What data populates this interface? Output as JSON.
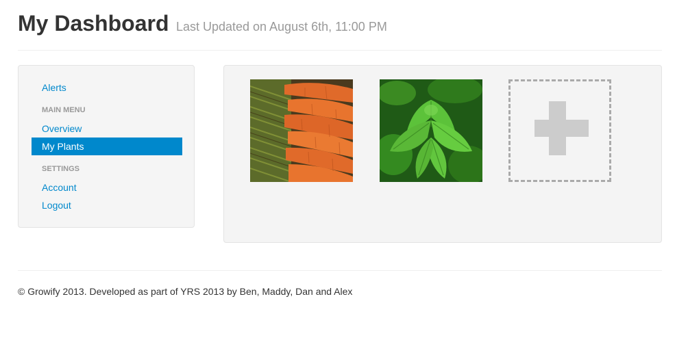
{
  "header": {
    "title": "My Dashboard",
    "subtitle": "Last Updated on August 6th, 11:00 PM"
  },
  "sidebar": {
    "alerts": "Alerts",
    "main_menu_header": "MAIN MENU",
    "overview": "Overview",
    "my_plants": "My Plants",
    "settings_header": "SETTINGS",
    "account": "Account",
    "logout": "Logout",
    "active_item": "My Plants"
  },
  "plants": [
    {
      "name": "carrot",
      "image": "carrots"
    },
    {
      "name": "mint",
      "image": "mint leaves"
    }
  ],
  "add_plant": {
    "icon": "plus-icon"
  },
  "footer": {
    "text": "© Growify 2013. Developed as part of YRS 2013 by Ben, Maddy, Dan and Alex"
  },
  "colors": {
    "accent": "#0088cc",
    "panel_bg": "#f5f5f5",
    "muted_text": "#999999",
    "plus": "#cccccc"
  }
}
